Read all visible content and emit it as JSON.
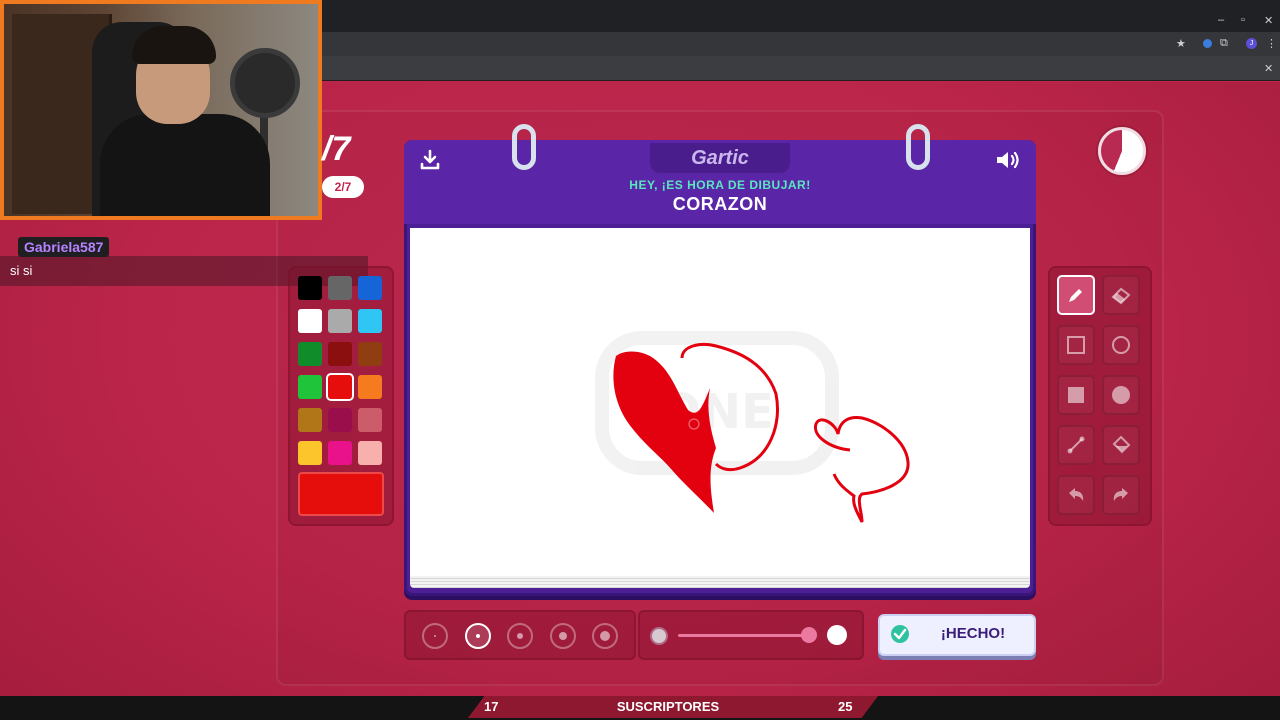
{
  "browser": {
    "window_controls": [
      "–",
      "▫",
      "✕"
    ],
    "close_tab": "✕",
    "avatar_initial": "J"
  },
  "stream": {
    "chat": {
      "username": "Gabriela587",
      "message": "si si"
    },
    "subs": {
      "current": "17",
      "label": "SUSCRIPTORES",
      "goal": "25"
    }
  },
  "game": {
    "logo": "Gartic",
    "round_big": "/7",
    "round_pill": "2/7",
    "hint": "HEY, ¡ES HORA DE DIBUJAR!",
    "word": "CORAZON",
    "done_label": "¡HECHO!",
    "timer_elapsed_fraction": 0.56,
    "palette": [
      "#000000",
      "#666666",
      "#1565d8",
      "#ffffff",
      "#aaaaaa",
      "#2fc6f5",
      "#108c2a",
      "#8c0f0f",
      "#8f3d11",
      "#1fc43b",
      "#e60d0d",
      "#f57b1e",
      "#b07618",
      "#9a0f4b",
      "#cc5c6a",
      "#fcc52b",
      "#ea128a",
      "#f8b0ac"
    ],
    "selected_color": "#e60d0d",
    "brush_sizes": 5,
    "selected_size_index": 1,
    "opacity_level": 0.96,
    "tools": [
      "pencil-icon",
      "eraser-icon",
      "rectangle-outline-icon",
      "circle-outline-icon",
      "rectangle-fill-icon",
      "circle-fill-icon",
      "line-icon",
      "fill-bucket-icon",
      "undo-icon",
      "redo-icon"
    ],
    "active_tool": "pencil-icon"
  }
}
